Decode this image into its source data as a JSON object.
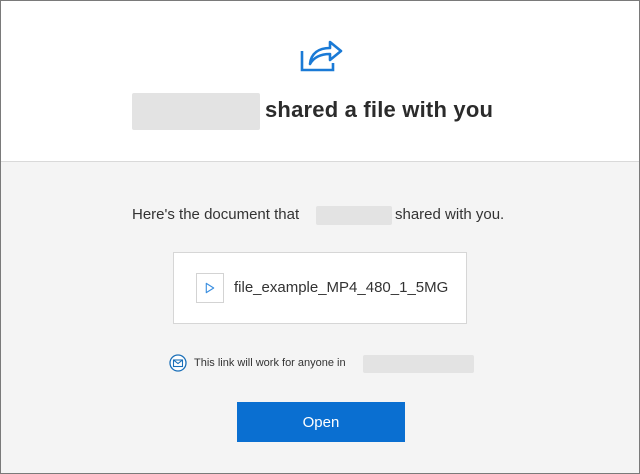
{
  "header": {
    "icon": "share-arrow-icon",
    "title_suffix": "shared a file with you"
  },
  "message": {
    "prefix": "Here's the document that",
    "suffix": "shared with you."
  },
  "file": {
    "icon": "video-play-icon",
    "name": "file_example_MP4_480_1_5MG"
  },
  "link_notice": {
    "icon": "org-link-icon",
    "text": "This link will work for anyone in"
  },
  "actions": {
    "open_label": "Open"
  },
  "colors": {
    "accent": "#0a6fd1",
    "icon_blue": "#1a7ad6",
    "body_bg": "#f4f4f4"
  }
}
